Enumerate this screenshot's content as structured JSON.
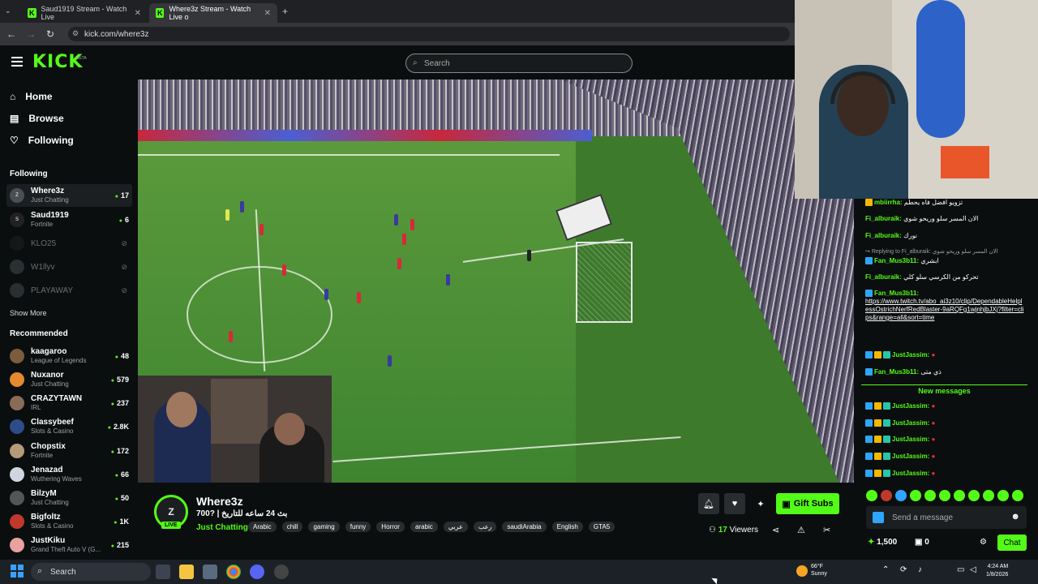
{
  "browser": {
    "tabs": [
      {
        "title": "Saud1919 Stream - Watch Live"
      },
      {
        "title": "Where3z Stream - Watch Live o"
      }
    ],
    "new_tab": "+",
    "url": "kick.com/where3z"
  },
  "header": {
    "logo": "KICK",
    "logo_badge": "BETA",
    "search_placeholder": "Search"
  },
  "sidebar": {
    "nav": [
      {
        "label": "Home",
        "icon": "home-icon"
      },
      {
        "label": "Browse",
        "icon": "browse-icon"
      },
      {
        "label": "Following",
        "icon": "heart-icon"
      }
    ],
    "following_title": "Following",
    "following": [
      {
        "name": "Where3z",
        "game": "Just Chatting",
        "viewers": "17",
        "live": true
      },
      {
        "name": "Saud1919",
        "game": "Fortnite",
        "viewers": "6",
        "live": true
      },
      {
        "name": "KLO25",
        "game": "",
        "viewers": "",
        "live": false
      },
      {
        "name": "W1llyv",
        "game": "",
        "viewers": "",
        "live": false
      },
      {
        "name": "PLAYAWAY",
        "game": "",
        "viewers": "",
        "live": false
      }
    ],
    "show_more": "Show More",
    "recommended_title": "Recommended",
    "recommended": [
      {
        "name": "kaagaroo",
        "game": "League of Legends",
        "viewers": "48"
      },
      {
        "name": "Nuxanor",
        "game": "Just Chatting",
        "viewers": "579"
      },
      {
        "name": "CRAZYTAWN",
        "game": "IRL",
        "viewers": "237"
      },
      {
        "name": "Classybeef",
        "game": "Slots & Casino",
        "viewers": "2.8K"
      },
      {
        "name": "Chopstix",
        "game": "Fortnite",
        "viewers": "172"
      },
      {
        "name": "Jenazad",
        "game": "Wuthering Waves",
        "viewers": "66"
      },
      {
        "name": "BilzyM",
        "game": "Just Chatting",
        "viewers": "50"
      },
      {
        "name": "Bigfoltz",
        "game": "Slots & Casino",
        "viewers": "1K"
      },
      {
        "name": "JustKiku",
        "game": "Grand Theft Auto V (G...",
        "viewers": "215"
      }
    ]
  },
  "stream": {
    "avatar_letter": "Z",
    "live_label": "LIVE",
    "channel": "Where3z",
    "title": "بث 24 ساعه للتاريخ | ?700",
    "category": "Just Chatting",
    "tags": [
      "Arabic",
      "chill",
      "gaming",
      "funny",
      "Horror",
      "arabic",
      "عربي",
      "رعب",
      "saudiArabia",
      "English",
      "GTA5"
    ],
    "gift_label": "Gift Subs",
    "viewers_count": "17",
    "viewers_label": "Viewers"
  },
  "chat": {
    "messages": [
      {
        "user": "mbiirrha:",
        "text": "تزويو افضل فاه يحطم"
      },
      {
        "user": "Fi_alburaik:",
        "text": "الان المسر سلو وريحو شوي"
      },
      {
        "user": "Fi_alburaik:",
        "text": "نورك"
      },
      {
        "user": "Fan_Mus3b11:",
        "text": "ابشري",
        "reply": "Replying to Fi_alburaik: الان المسر سلو وريحو شوي"
      },
      {
        "user": "Fi_alburaik:",
        "text": "تحركو من الكرسي سلو كلي"
      },
      {
        "user": "Fan_Mus3b11:",
        "text": "https://www.twitch.tv/abo_ai3z10/clip/DependableHelplessOstrichNerfRedBlaster-9aRQFg1wjnhjbJXj?filter=clips&range=all&sort=time"
      },
      {
        "user": "JustJassim:",
        "text": ""
      },
      {
        "user": "Fan_Mus3b11:",
        "text": "ذي متى"
      }
    ],
    "new_messages_label": "New messages",
    "new_messages": [
      {
        "user": "JustJassim:"
      },
      {
        "user": "JustJassim:"
      },
      {
        "user": "JustJassim:"
      },
      {
        "user": "JustJassim:"
      },
      {
        "user": "JustJassim:"
      }
    ],
    "input_placeholder": "Send a message",
    "points": "1,500",
    "gifts_count": "0",
    "chat_button": "Chat"
  },
  "taskbar": {
    "search": "Search",
    "weather_temp": "66°F",
    "weather_desc": "Sunny",
    "time": "4:24 AM",
    "date": "1/8/2026"
  },
  "colors": {
    "accent": "#53fc18",
    "bg": "#0b0e0f"
  }
}
